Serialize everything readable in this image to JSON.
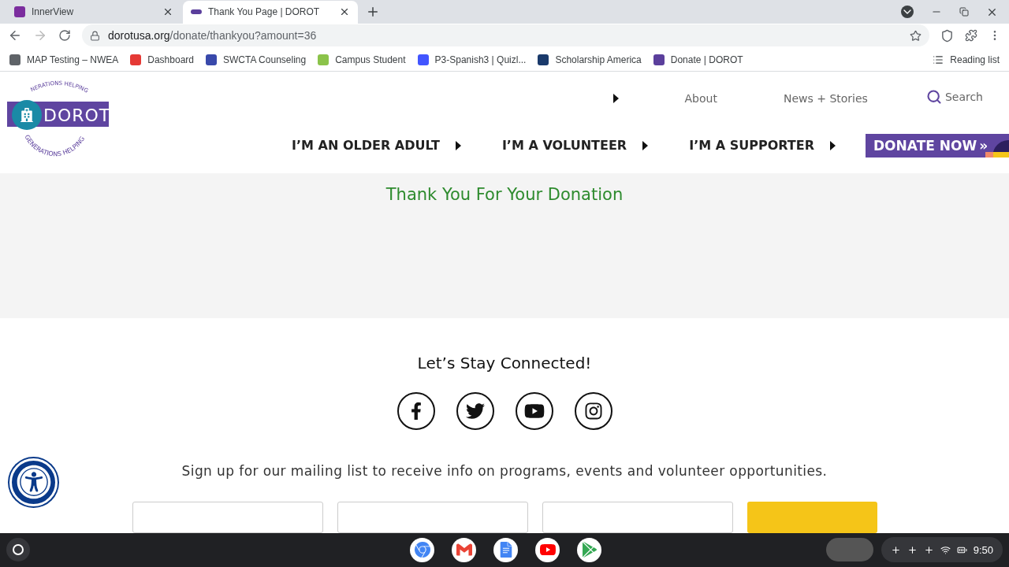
{
  "browser": {
    "tabs": [
      {
        "title": "InnerView",
        "selected": false,
        "color": "#7b2d9e"
      },
      {
        "title": "Thank You Page | DOROT",
        "selected": true,
        "color": "#5b3f9c"
      }
    ],
    "address": {
      "host": "dorotusa.org",
      "path": "/donate/thankyou?amount=36"
    },
    "bookmarks": [
      {
        "label": "MAP Testing – NWEA",
        "color": "#5f6368"
      },
      {
        "label": "Dashboard",
        "color": "#e53935"
      },
      {
        "label": "SWCTA Counseling",
        "color": "#3949ab"
      },
      {
        "label": "Campus Student",
        "color": "#8bc34a"
      },
      {
        "label": "P3-Spanish3 | Quizl...",
        "color": "#4255ff"
      },
      {
        "label": "Scholarship America",
        "color": "#1a3a6b"
      },
      {
        "label": "Donate | DOROT",
        "color": "#5b3f9c"
      }
    ],
    "reading_list": "Reading list"
  },
  "site": {
    "logo": {
      "ring_top": "NERATIONS HELPING",
      "name": "DOROT",
      "ring_bottom": "GENERATIONS HELPING"
    },
    "top_links": [
      "About",
      "News + Stories"
    ],
    "search": "Search",
    "main_nav": [
      "I’M AN OLDER ADULT",
      "I’M A VOLUNTEER",
      "I’M A SUPPORTER"
    ],
    "donate": "DONATE NOW",
    "donate_mark": "»"
  },
  "thank_you": "Thank You For Your Donation",
  "footer": {
    "heading": "Let’s Stay Connected!",
    "signup_text": "Sign up for our mailing list to receive info on programs, events and volunteer opportunities.",
    "signup_fields": [
      {
        "kind": "input"
      },
      {
        "kind": "input"
      },
      {
        "kind": "input"
      },
      {
        "kind": "button"
      }
    ]
  },
  "taskbar": {
    "time": "9:50"
  }
}
